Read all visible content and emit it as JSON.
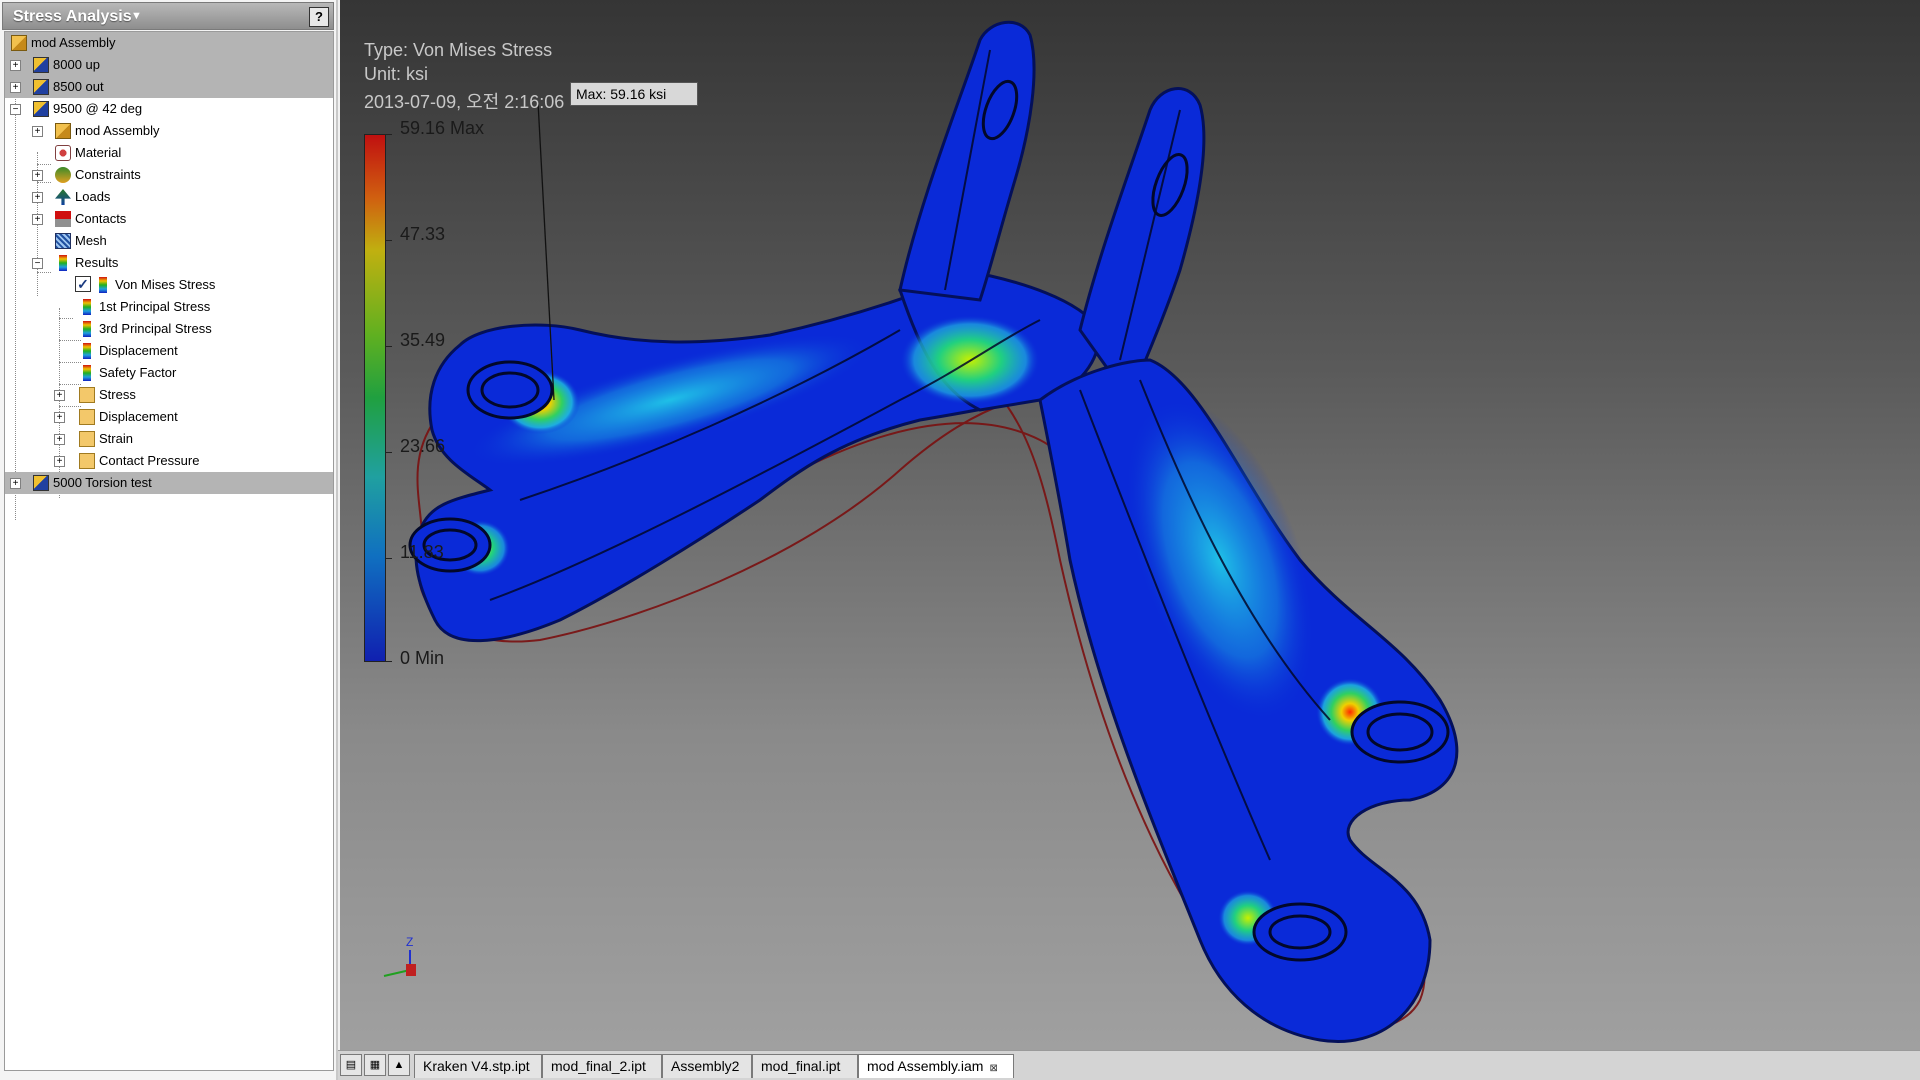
{
  "browser": {
    "title": "Stress Analysis",
    "help": "?",
    "tree": [
      {
        "label": "mod Assembly"
      },
      {
        "label": "8000 up"
      },
      {
        "label": "8500 out"
      },
      {
        "label": "9500 @ 42 deg"
      },
      {
        "label": "mod Assembly"
      },
      {
        "label": "Material"
      },
      {
        "label": "Constraints"
      },
      {
        "label": "Loads"
      },
      {
        "label": "Contacts"
      },
      {
        "label": "Mesh"
      },
      {
        "label": "Results"
      },
      {
        "label": "Von Mises Stress"
      },
      {
        "label": "1st Principal Stress"
      },
      {
        "label": "3rd Principal Stress"
      },
      {
        "label": "Displacement"
      },
      {
        "label": "Safety Factor"
      },
      {
        "label": "Stress"
      },
      {
        "label": "Displacement"
      },
      {
        "label": "Strain"
      },
      {
        "label": "Contact Pressure"
      },
      {
        "label": "5000 Torsion test"
      }
    ]
  },
  "viewport": {
    "type_line": "Type: Von Mises Stress",
    "unit_line": "Unit: ksi",
    "date_line": "2013-07-09, 오전 2:16:06",
    "max_tag": "Max: 59.16 ksi",
    "scale_labels": [
      "59.16 Max",
      "47.33",
      "35.49",
      "23.66",
      "11.83",
      "0 Min"
    ],
    "colors": {
      "high": "#c01010",
      "low": "#1020b0",
      "part_body": "#0a2ad8"
    }
  },
  "tabs": {
    "items": [
      "Kraken V4.stp.ipt",
      "mod_final_2.ipt",
      "Assembly2",
      "mod_final.ipt",
      "mod Assembly.iam"
    ],
    "active": "mod Assembly.iam",
    "close_glyph": "⊠"
  }
}
